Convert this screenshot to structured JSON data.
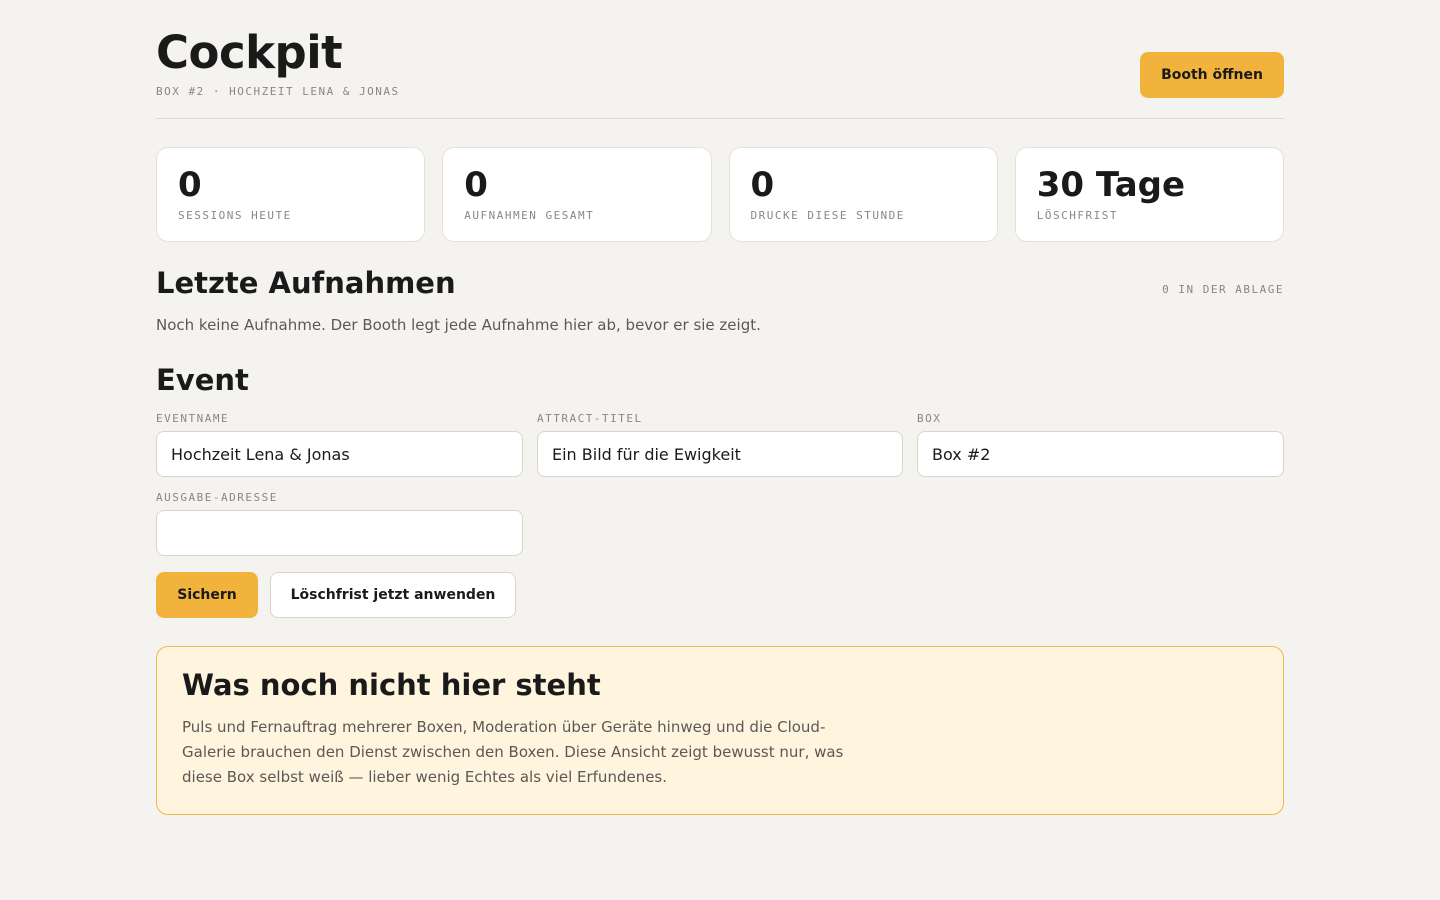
{
  "header": {
    "title": "Cockpit",
    "subtitle": "BOX #2 · HOCHZEIT LENA & JONAS",
    "open_booth_label": "Booth öffnen"
  },
  "stats": [
    {
      "value": "0",
      "label": "SESSIONS HEUTE"
    },
    {
      "value": "0",
      "label": "AUFNAHMEN GESAMT"
    },
    {
      "value": "0",
      "label": "DRUCKE DIESE STUNDE"
    },
    {
      "value": "30 Tage",
      "label": "LÖSCHFRIST"
    }
  ],
  "recent": {
    "title": "Letzte Aufnahmen",
    "count_label": "0 IN DER ABLAGE",
    "empty_text": "Noch keine Aufnahme. Der Booth legt jede Aufnahme hier ab, bevor er sie zeigt."
  },
  "event": {
    "title": "Event",
    "fields": {
      "eventname": {
        "label": "EVENTNAME",
        "value": "Hochzeit Lena & Jonas"
      },
      "attract_title": {
        "label": "ATTRACT-TITEL",
        "value": "Ein Bild für die Ewigkeit"
      },
      "box": {
        "label": "BOX",
        "value": "Box #2"
      },
      "output_address": {
        "label": "AUSGABE-ADRESSE",
        "value": ""
      }
    },
    "save_label": "Sichern",
    "apply_retention_label": "Löschfrist jetzt anwenden"
  },
  "notice": {
    "title": "Was noch nicht hier steht",
    "text": "Puls und Fernauftrag mehrerer Boxen, Moderation über Geräte hinweg und die Cloud-Galerie brauchen den Dienst zwischen den Boxen. Diese Ansicht zeigt bewusst nur, was diese Box selbst weiß — lieber wenig Echtes als viel Erfundenes."
  },
  "colors": {
    "accent": "#f2b33d",
    "background": "#f5f3ef",
    "notice_background": "#fff4de",
    "notice_border": "#ecb84f"
  }
}
